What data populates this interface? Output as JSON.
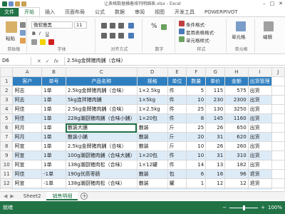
{
  "window": {
    "title": "让表格数据横着排列明细表.xlsx - Excel"
  },
  "ribbon_tabs": [
    "文件",
    "开始",
    "插入",
    "页面布局",
    "公式",
    "数据",
    "审阅",
    "视图",
    "开发工具",
    "POWERPIVOT"
  ],
  "ribbon": {
    "paste_label": "粘贴",
    "clipboard_label": "剪贴板",
    "font_name": "微软雅黑",
    "font_size": "11",
    "font_label": "字体",
    "align_label": "对齐方式",
    "number_label": "数字",
    "percent": "%",
    "cond_format": "条件格式·",
    "table_format": "套用表格格式·",
    "cell_style": "单元格样式·",
    "styles_label": "样式",
    "cells_btn": "单元格",
    "cells_label": "单元格",
    "edit_btn": "编辑"
  },
  "formula_bar": {
    "name_box": "D6",
    "cancel": "✕",
    "enter": "✓",
    "fx": "fx",
    "content": "2.5kg金牌猪肉脯（合味）"
  },
  "columns": [
    "A",
    "B",
    "C",
    "D",
    "E",
    "F",
    "G",
    "H",
    "I",
    "J"
  ],
  "header_row": [
    "客户",
    "单号",
    "产品名称",
    "规格",
    "单位",
    "数量",
    "单价",
    "金额",
    "出货管理"
  ],
  "rows": [
    {
      "n": "2",
      "cells": [
        "阿志",
        "1单",
        "2.5kg金牌猪肉脯（合味）",
        "1×2.5kg",
        "件",
        "5",
        "115",
        "575",
        "出货"
      ]
    },
    {
      "n": "3",
      "cells": [
        "阿志",
        "1单",
        "5kg连拌猪肉脯",
        "1×5kg",
        "件",
        "10",
        "230",
        "2300",
        "出货"
      ]
    },
    {
      "n": "4",
      "cells": [
        "阿佳",
        "1单",
        "2.5kg金牌猪肉脯（合味）",
        "1×2.5kg",
        "件",
        "25",
        "130",
        "3250",
        "出货"
      ]
    },
    {
      "n": "5",
      "cells": [
        "阿佳",
        "1单",
        "228g潮厨猪肉脯（合味小脯）",
        "1×20包",
        "件",
        "8",
        "145",
        "1160",
        "出货"
      ]
    },
    {
      "n": "6",
      "cells": [
        "阿月",
        "1单",
        "散装大脯",
        "散装",
        "斤",
        "25",
        "26",
        "650",
        "出货"
      ]
    },
    {
      "n": "7",
      "cells": [
        "阿月",
        "1单",
        "散装小脯",
        "散装",
        "斤",
        "20",
        "31",
        "620",
        "出货"
      ]
    },
    {
      "n": "8",
      "cells": [
        "阿宣",
        "1单",
        "2.5kg金牌猪肉脯（合味）",
        "散装",
        "斤",
        "10",
        "26",
        "260",
        "出货"
      ]
    },
    {
      "n": "9",
      "cells": [
        "阿宣",
        "1单",
        "100g潮厨猪肉脯（合味大脯）",
        "1×20包",
        "件",
        "10",
        "31",
        "310",
        "出货"
      ]
    },
    {
      "n": "10",
      "cells": [
        "阿宣",
        "1单",
        "138g潮厨猪肉松（合味）",
        "1×12罐",
        "件",
        "14",
        "13",
        "182",
        "出货"
      ]
    },
    {
      "n": "11",
      "cells": [
        "阿佳",
        "-1单",
        "190g优质枣肠",
        "散装",
        "包",
        "6",
        "16",
        "96",
        "退货"
      ]
    },
    {
      "n": "12",
      "cells": [
        "阿宣",
        "-1单",
        "138g潮厨猪肉松（合味）",
        "散装",
        "罐",
        "1",
        "12",
        "12",
        "退货"
      ]
    },
    {
      "n": "13",
      "cells": [
        "阿宣",
        "-1单",
        "200G连拌猪肉 咸肉",
        "散装",
        "包",
        "2",
        "12",
        "24",
        "退货"
      ]
    },
    {
      "n": "14",
      "cells": [
        "阿佳",
        "-1单",
        "138g潮厨猪肉松（合味）",
        "散装",
        "罐",
        "1",
        "12.5",
        "12.5",
        "退货"
      ]
    },
    {
      "n": "15",
      "cells": [
        "",
        "",
        "",
        "",
        "",
        "",
        "",
        "",
        ""
      ]
    }
  ],
  "sheet_tabs": [
    "Sheet2",
    "销售明细"
  ],
  "active_sheet": 1,
  "status": {
    "ready": "就绪",
    "zoom": "100%",
    "minus": "−",
    "plus": "+"
  },
  "colors": {
    "accent": "#217346",
    "header": "#2f7fc0",
    "band": "#ddebf7"
  },
  "zoom_level": 0.5
}
